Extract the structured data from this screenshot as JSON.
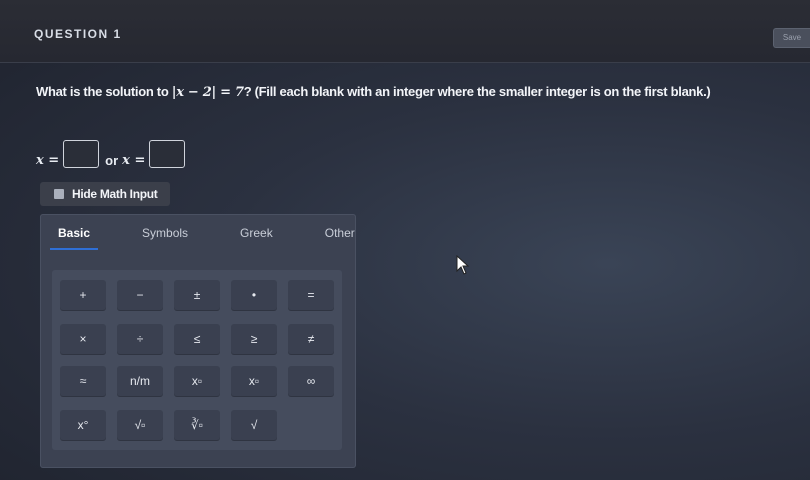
{
  "header": {
    "question_label": "QUESTION 1",
    "save_label": "Save"
  },
  "question": {
    "prefix": "What is the solution to ",
    "equation": "|x − 2| = 7",
    "suffix": "? (Fill each blank with an integer where the smaller integer is on the first blank.)"
  },
  "answer": {
    "var1": "x =",
    "or_text": "or",
    "var2": "x =",
    "blank1_value": "",
    "blank2_value": ""
  },
  "math_input": {
    "toggle_label": "Hide Math Input",
    "tabs": [
      "Basic",
      "Symbols",
      "Greek",
      "Other"
    ],
    "active_tab": "Basic",
    "keys": [
      [
        "+",
        "−",
        "±",
        "•",
        "="
      ],
      [
        "×",
        "÷",
        "≤",
        "≥",
        "≠"
      ],
      [
        "≈",
        "n/m",
        "x▫",
        "x▫",
        "∞"
      ],
      [
        "x°",
        "√▫",
        "∛▫",
        "√"
      ]
    ]
  }
}
